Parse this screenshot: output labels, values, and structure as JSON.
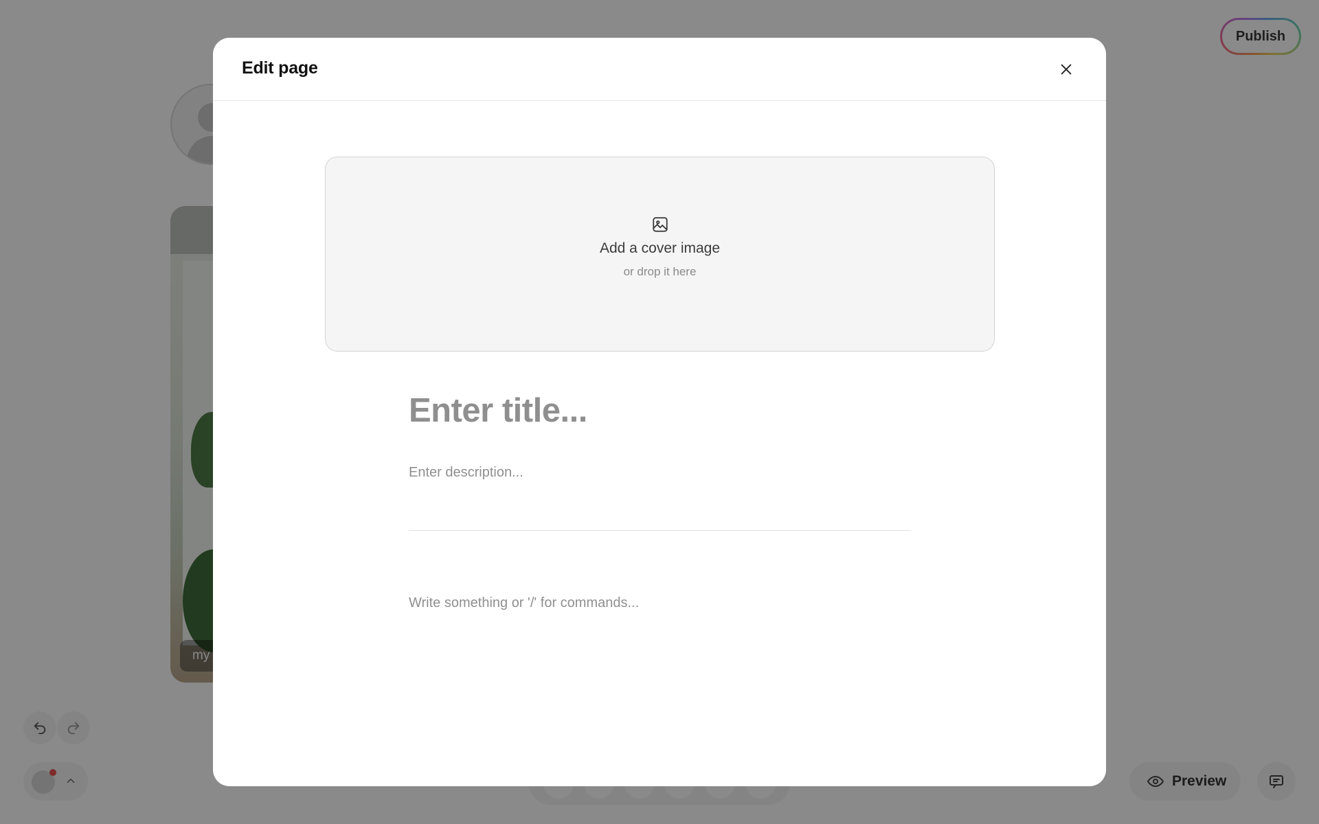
{
  "background": {
    "publish_label": "Publish",
    "photo_caption": "my",
    "preview_label": "Preview",
    "publish_gradient": [
      "#f6a04d",
      "#f36c8e",
      "#b57cf2",
      "#6aa7f5",
      "#6fd6b1",
      "#e9d25e"
    ],
    "notification_dot_color": "#e8504f"
  },
  "modal": {
    "title": "Edit page",
    "cover": {
      "label": "Add a cover image",
      "sub_label": "or drop it here"
    },
    "title_placeholder": "Enter title...",
    "description_placeholder": "Enter description...",
    "body_placeholder": "Write something or '/' for commands..."
  },
  "icons": {
    "close": "close-icon",
    "cover": "image-icon",
    "undo": "undo-icon",
    "redo": "redo-icon",
    "preview": "eye-icon",
    "chat": "comment-icon"
  }
}
